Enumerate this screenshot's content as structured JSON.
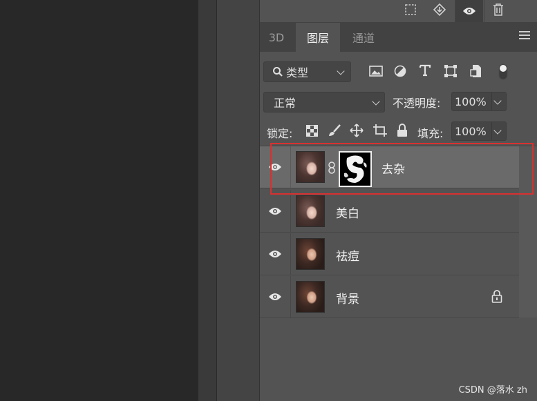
{
  "top_toolbar": {
    "icons": [
      "marquee-select-icon",
      "stamp-down-icon",
      "eye-icon",
      "trash-icon"
    ]
  },
  "tabs": [
    {
      "label": "3D"
    },
    {
      "label": "图层"
    },
    {
      "label": "通道"
    }
  ],
  "active_tab": "图层",
  "filter": {
    "kind_label": "类型",
    "icons": [
      "image-filter-icon",
      "adjustment-filter-icon",
      "type-filter-icon",
      "shape-filter-icon",
      "smart-object-filter-icon",
      "filter-toggle-icon"
    ]
  },
  "blend": {
    "mode": "正常",
    "opacity_label": "不透明度:",
    "opacity_value": "100%"
  },
  "lock": {
    "label": "锁定:",
    "icons": [
      "lock-transparent-pixels-icon",
      "lock-image-pixels-icon",
      "lock-position-icon",
      "lock-artboard-icon",
      "lock-all-icon"
    ],
    "fill_label": "填充:",
    "fill_value": "100%"
  },
  "layers": [
    {
      "name": "去杂",
      "visible": true,
      "selected": true,
      "has_mask": true,
      "locked": false
    },
    {
      "name": "美白",
      "visible": true,
      "selected": false,
      "has_mask": false,
      "locked": false
    },
    {
      "name": "祛痘",
      "visible": true,
      "selected": false,
      "has_mask": false,
      "locked": false
    },
    {
      "name": "背景",
      "visible": true,
      "selected": false,
      "has_mask": false,
      "locked": true
    }
  ],
  "watermark": "CSDN @落水 zh",
  "colors": {
    "highlight_border": "#d93030",
    "selected_layer_bg": "#6a6a6a",
    "panel_bg": "#535353"
  }
}
